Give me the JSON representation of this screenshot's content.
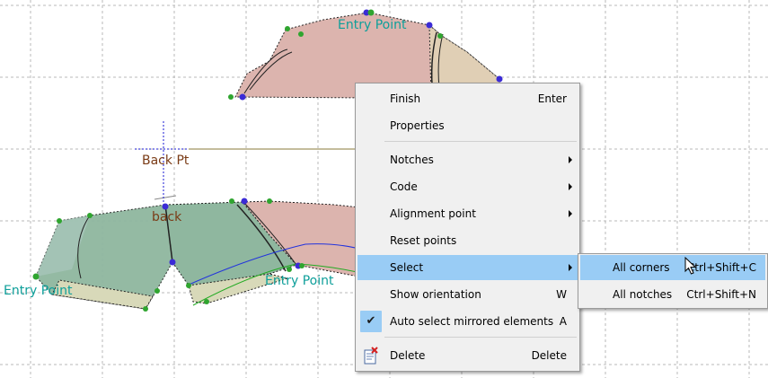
{
  "canvas": {
    "labels": {
      "entry_point_top": "Entry Point",
      "entry_point_left": "Entry Point",
      "entry_point_mid": "Entry Point",
      "back_pt": "Back Pt",
      "back": "back"
    },
    "colors": {
      "piece_pink": "#dcb4ae",
      "piece_green": "#8fb79f",
      "piece_tan": "#e0cfb5",
      "point_blue": "#3b2bd6",
      "point_green": "#2fa52f",
      "label_teal": "#0e9f9a",
      "label_brown": "#7a3b16"
    }
  },
  "context_menu": {
    "items": [
      {
        "label": "Finish",
        "shortcut": "Enter"
      },
      {
        "label": "Properties"
      },
      {
        "label": "Notches",
        "submenu": true
      },
      {
        "label": "Code",
        "submenu": true
      },
      {
        "label": "Alignment point",
        "submenu": true
      },
      {
        "label": "Reset points"
      },
      {
        "label": "Select",
        "submenu": true,
        "highlighted": true
      },
      {
        "label": "Show orientation",
        "shortcut": "W"
      },
      {
        "label": "Auto select mirrored elements",
        "shortcut": "A",
        "checked": true
      },
      {
        "label": "Delete",
        "shortcut": "Delete",
        "icon": "delete-icon"
      }
    ]
  },
  "submenu": {
    "items": [
      {
        "label": "All corners",
        "shortcut": "Ctrl+Shift+C",
        "highlighted": true
      },
      {
        "label": "All notches",
        "shortcut": "Ctrl+Shift+N"
      }
    ]
  }
}
